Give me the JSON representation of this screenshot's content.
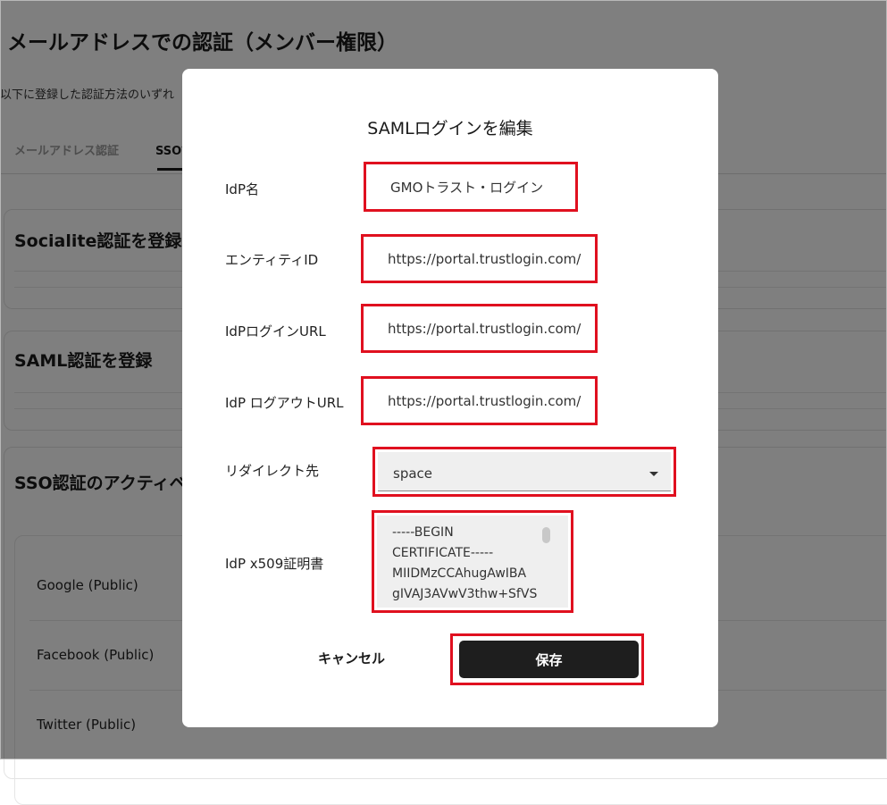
{
  "page": {
    "title": "メールアドレスでの認証（メンバー権限）",
    "description": "以下に登録した認証方法のいずれ",
    "tabs": [
      {
        "label": "メールアドレス認証"
      },
      {
        "label": "SSO認"
      }
    ]
  },
  "sections": {
    "socialite_title": "Socialite認証を登録",
    "saml_title": "SAML認証を登録",
    "active_title": "SSO認証のアクティベ",
    "providers": [
      "Google (Public)",
      "Facebook (Public)",
      "Twitter (Public)"
    ]
  },
  "modal": {
    "title": "SAMLログインを編集",
    "fields": {
      "idp_name": {
        "label": "IdP名",
        "value": "GMOトラスト・ログイン"
      },
      "entity_id": {
        "label": "エンティティID",
        "value": "https://portal.trustlogin.com/"
      },
      "login_url": {
        "label": "IdPログインURL",
        "value": "https://portal.trustlogin.com/"
      },
      "logout_url": {
        "label": "IdP ログアウトURL",
        "value": "https://portal.trustlogin.com/"
      },
      "redirect": {
        "label": "リダイレクト先",
        "value": "space"
      },
      "cert": {
        "label": "IdP x509証明書",
        "lines": [
          "-----BEGIN",
          "CERTIFICATE-----",
          "MIIDMzCCAhugAwIBA",
          "gIVAJ3AVwV3thw+SfVS"
        ]
      }
    },
    "cancel_label": "キャンセル",
    "save_label": "保存"
  },
  "colors": {
    "highlight": "#e0101f",
    "overlay": "rgba(0,0,0,0.5)",
    "save_button": "#1e1e1e"
  }
}
